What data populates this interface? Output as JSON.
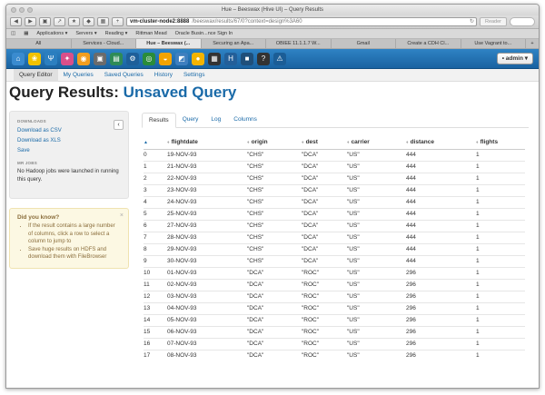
{
  "window": {
    "title": "Hue – Beeswax (Hive UI) – Query Results"
  },
  "browser": {
    "url_host": "vm-cluster-node2:8888",
    "url_path": "/beeswax/results/67/0?context=design%3A60",
    "reader_label": "Reader",
    "reload_icon": "reload-icon"
  },
  "bookmarks": [
    "Applications ▾",
    "Servers ▾",
    "Reading ▾",
    "Rittman Mead",
    "Oracle Busin...nce Sign In"
  ],
  "browser_tabs": [
    {
      "label": "All",
      "active": false
    },
    {
      "label": "Services - Cloud...",
      "active": false
    },
    {
      "label": "Hue – Beeswax (...",
      "active": true
    },
    {
      "label": "Securing an Apa...",
      "active": false
    },
    {
      "label": "OBIEE 11.1.1.7 W...",
      "active": false
    },
    {
      "label": "Gmail",
      "active": false
    },
    {
      "label": "Create a CDH Cl...",
      "active": false
    },
    {
      "label": "Use Vagrant to...",
      "active": false
    }
  ],
  "tab_plus": "+",
  "hue_nav": {
    "apps": [
      {
        "icon": "home-icon",
        "glyph": "⌂",
        "color": "#3a8bcf"
      },
      {
        "icon": "hue-logo-icon",
        "glyph": "❀",
        "color": "#f2c200"
      },
      {
        "icon": "pig-icon",
        "glyph": "Ψ",
        "color": "#2c7fc0"
      },
      {
        "icon": "beeswax-icon",
        "glyph": "✦",
        "color": "#d94f8a"
      },
      {
        "icon": "impala-icon",
        "glyph": "◉",
        "color": "#f29e1f"
      },
      {
        "icon": "metastore-icon",
        "glyph": "▣",
        "color": "#6b6b6b"
      },
      {
        "icon": "pig-editor-icon",
        "glyph": "▤",
        "color": "#2e8b57"
      },
      {
        "icon": "jobsub-icon",
        "glyph": "⚙",
        "color": "#1e5f99"
      },
      {
        "icon": "oozie-icon",
        "glyph": "◎",
        "color": "#2a8c3a"
      },
      {
        "icon": "hbase-icon",
        "glyph": "◒",
        "color": "#f4a300"
      },
      {
        "icon": "sqoop-icon",
        "glyph": "◩",
        "color": "#3e7fbf"
      },
      {
        "icon": "zookeeper-icon",
        "glyph": "●",
        "color": "#f4b400"
      },
      {
        "icon": "search-app-icon",
        "glyph": "▦",
        "color": "#333333"
      },
      {
        "icon": "filebrowser-icon",
        "glyph": "H",
        "color": "#235f99"
      },
      {
        "icon": "jobbrowser-icon",
        "glyph": "■",
        "color": "#1f4f7a"
      },
      {
        "icon": "help-icon",
        "glyph": "?",
        "color": "#333333"
      },
      {
        "icon": "warning-icon",
        "glyph": "⚠",
        "color": "#1b5d96"
      }
    ],
    "admin_label": "• admin ▾"
  },
  "subnav": [
    {
      "label": "Query Editor",
      "active": false
    },
    {
      "label": "My Queries",
      "active": false
    },
    {
      "label": "Saved Queries",
      "active": false
    },
    {
      "label": "History",
      "active": false
    },
    {
      "label": "Settings",
      "active": false
    }
  ],
  "page": {
    "title_prefix": "Query Results:",
    "title_accent": "Unsaved Query"
  },
  "sidebar": {
    "downloads_header": "DOWNLOADS",
    "download_csv": "Download as CSV",
    "download_xls": "Download as XLS",
    "save": "Save",
    "mr_header": "MR JOBS",
    "mr_text": "No Hadoop jobs were launched in running this query.",
    "collapse_glyph": "‹"
  },
  "tip": {
    "title": "Did you know?",
    "close_glyph": "×",
    "items": [
      "If the result contains a large number of columns, click a row to select a column to jump to",
      "Save huge results on HDFS and download them with FileBrowser"
    ]
  },
  "result_tabs": [
    {
      "label": "Results",
      "active": true
    },
    {
      "label": "Query",
      "active": false
    },
    {
      "label": "Log",
      "active": false
    },
    {
      "label": "Columns",
      "active": false
    }
  ],
  "table": {
    "headers": [
      "",
      "flightdate",
      "origin",
      "dest",
      "carrier",
      "distance",
      "flights"
    ],
    "sort_glyph": "♦",
    "sort_active_glyph": "▲",
    "rows": [
      [
        "0",
        "19-NOV-93",
        "\"CHS\"",
        "\"DCA\"",
        "\"US\"",
        "444",
        "1"
      ],
      [
        "1",
        "21-NOV-93",
        "\"CHS\"",
        "\"DCA\"",
        "\"US\"",
        "444",
        "1"
      ],
      [
        "2",
        "22-NOV-93",
        "\"CHS\"",
        "\"DCA\"",
        "\"US\"",
        "444",
        "1"
      ],
      [
        "3",
        "23-NOV-93",
        "\"CHS\"",
        "\"DCA\"",
        "\"US\"",
        "444",
        "1"
      ],
      [
        "4",
        "24-NOV-93",
        "\"CHS\"",
        "\"DCA\"",
        "\"US\"",
        "444",
        "1"
      ],
      [
        "5",
        "25-NOV-93",
        "\"CHS\"",
        "\"DCA\"",
        "\"US\"",
        "444",
        "1"
      ],
      [
        "6",
        "27-NOV-93",
        "\"CHS\"",
        "\"DCA\"",
        "\"US\"",
        "444",
        "1"
      ],
      [
        "7",
        "28-NOV-93",
        "\"CHS\"",
        "\"DCA\"",
        "\"US\"",
        "444",
        "1"
      ],
      [
        "8",
        "29-NOV-93",
        "\"CHS\"",
        "\"DCA\"",
        "\"US\"",
        "444",
        "1"
      ],
      [
        "9",
        "30-NOV-93",
        "\"CHS\"",
        "\"DCA\"",
        "\"US\"",
        "444",
        "1"
      ],
      [
        "10",
        "01-NOV-93",
        "\"DCA\"",
        "\"ROC\"",
        "\"US\"",
        "296",
        "1"
      ],
      [
        "11",
        "02-NOV-93",
        "\"DCA\"",
        "\"ROC\"",
        "\"US\"",
        "296",
        "1"
      ],
      [
        "12",
        "03-NOV-93",
        "\"DCA\"",
        "\"ROC\"",
        "\"US\"",
        "296",
        "1"
      ],
      [
        "13",
        "04-NOV-93",
        "\"DCA\"",
        "\"ROC\"",
        "\"US\"",
        "296",
        "1"
      ],
      [
        "14",
        "05-NOV-93",
        "\"DCA\"",
        "\"ROC\"",
        "\"US\"",
        "296",
        "1"
      ],
      [
        "15",
        "06-NOV-93",
        "\"DCA\"",
        "\"ROC\"",
        "\"US\"",
        "296",
        "1"
      ],
      [
        "16",
        "07-NOV-93",
        "\"DCA\"",
        "\"ROC\"",
        "\"US\"",
        "296",
        "1"
      ],
      [
        "17",
        "08-NOV-93",
        "\"DCA\"",
        "\"ROC\"",
        "\"US\"",
        "296",
        "1"
      ]
    ]
  }
}
